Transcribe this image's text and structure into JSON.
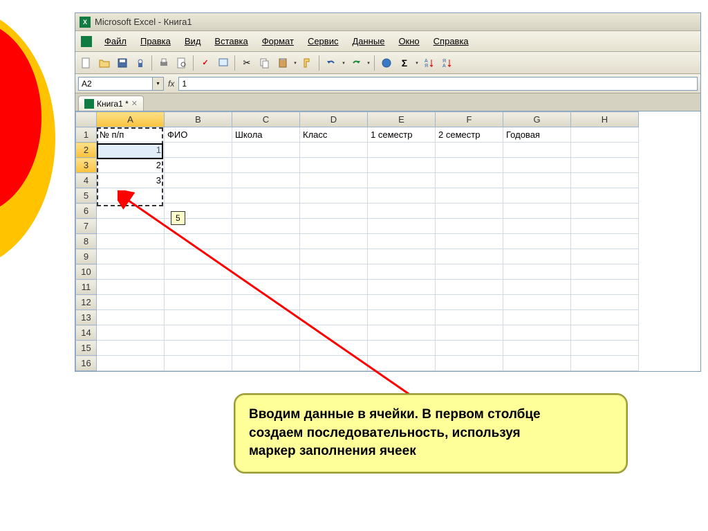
{
  "titleBar": {
    "appName": "Microsoft Excel - Книга1"
  },
  "menu": {
    "items": [
      "Файл",
      "Правка",
      "Вид",
      "Вставка",
      "Формат",
      "Сервис",
      "Данные",
      "Окно",
      "Справка"
    ]
  },
  "formulaBar": {
    "nameBox": "A2",
    "fxLabel": "fx",
    "formula": "1"
  },
  "docTab": {
    "label": "Книга1 *"
  },
  "grid": {
    "columns": [
      "A",
      "B",
      "C",
      "D",
      "E",
      "F",
      "G",
      "H"
    ],
    "rowCount": 16,
    "headers": {
      "A": "№ п/п",
      "B": "ФИО",
      "C": "Школа",
      "D": "Класс",
      "E": "1 семестр",
      "F": "2 семестр",
      "G": "Годовая"
    },
    "data": {
      "A2": "1",
      "A3": "2",
      "A4": "3"
    },
    "fillHint": "5",
    "activeColumn": "A",
    "activeRows": [
      "2",
      "3"
    ],
    "marchingRange": "A2:A6"
  },
  "callout": {
    "line1": "Вводим данные в ячейки. В первом столбце",
    "line2": "создаем последовательность, используя",
    "line3": "маркер заполнения ячеек"
  },
  "icons": {
    "new": "📄",
    "open": "📂",
    "save": "💾",
    "print": "🖨",
    "preview": "🔍",
    "spell": "✓",
    "cut": "✂",
    "copy": "⧉",
    "paste": "📋",
    "format": "🖌",
    "undo": "↶",
    "redo": "↷",
    "link": "🔗",
    "sum": "Σ",
    "sortAsc": "A↓",
    "sortDesc": "A↑"
  }
}
